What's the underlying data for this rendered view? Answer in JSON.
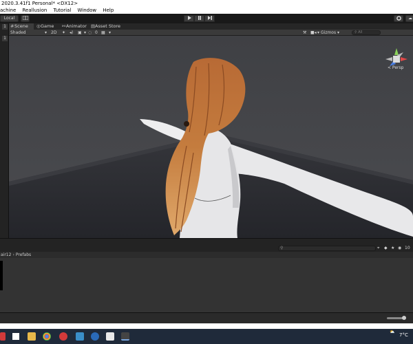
{
  "titlebar": {
    "text": "2020.3.41f1 Personal* <DX12>"
  },
  "menu": {
    "items": [
      "achine",
      "Reallusion",
      "Tutorial",
      "Window",
      "Help"
    ]
  },
  "toolbar": {
    "local_label": "Local",
    "play_icon": "play-icon",
    "pause_icon": "pause-icon",
    "step_icon": "step-icon"
  },
  "left_strip": {
    "numbers": [
      "1",
      "1"
    ]
  },
  "tabs": [
    {
      "label": "Scene",
      "icon": "hash-icon",
      "active": true
    },
    {
      "label": "Game",
      "icon": "gamepad-icon",
      "active": false
    },
    {
      "label": "Animator",
      "icon": "animator-icon",
      "active": false
    },
    {
      "label": "Asset Store",
      "icon": "store-icon",
      "active": false
    }
  ],
  "scene_toolbar": {
    "shading": "Shaded",
    "mode_2d": "2D",
    "gizmos": "Gizmos",
    "search_placeholder": "All",
    "fx_count": "0"
  },
  "viewport": {
    "persp_label": "< Persp",
    "sky_color": "#46474a",
    "ground_color": "#2c2c30"
  },
  "project": {
    "breadcrumb": [
      "air12",
      "Prefabs"
    ],
    "count": "10"
  },
  "taskbar": {
    "weather": "7°C",
    "icons": [
      "file-explorer-icon",
      "chrome-icon",
      "opera-icon",
      "unity-hub-icon",
      "ccleaner-icon",
      "unity-icon",
      "unity-editor-icon"
    ]
  }
}
